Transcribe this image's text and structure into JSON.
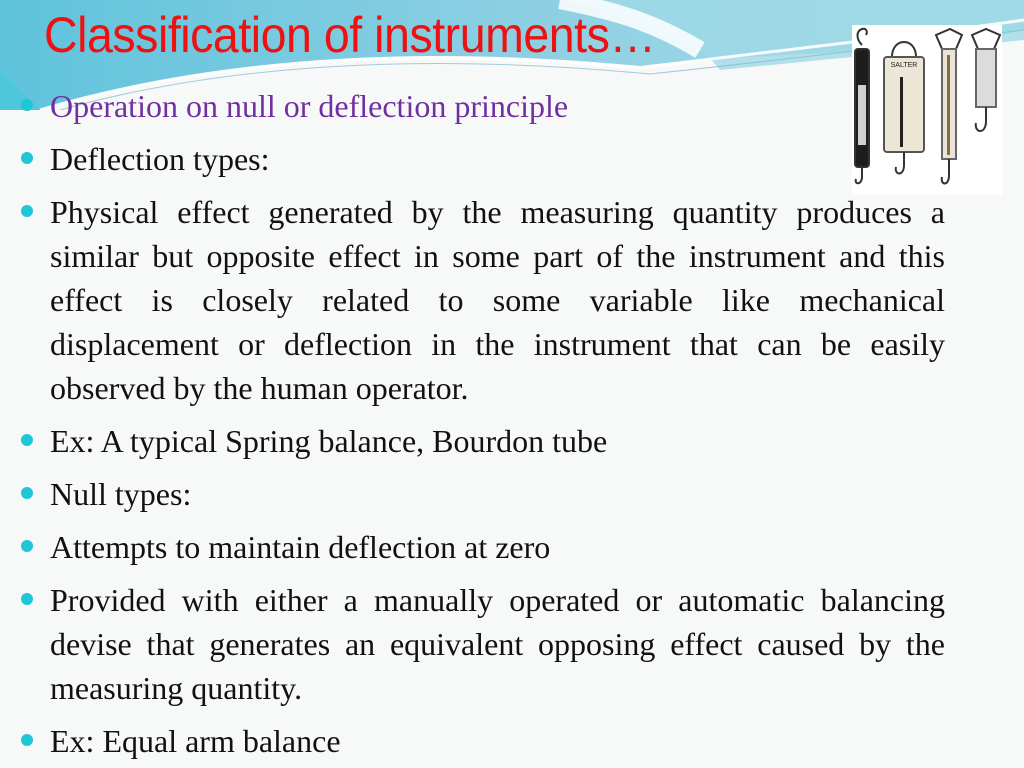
{
  "slide": {
    "title": "Classification of instruments…",
    "image_alt": "spring balances",
    "image_label": "SALTER",
    "bullets": [
      {
        "text": "Operation on null or deflection principle",
        "style": "highlight"
      },
      {
        "text": "Deflection types:",
        "style": "normal"
      },
      {
        "text": "Physical effect generated by the measuring quantity produces a similar but opposite effect in some part of the instrument and this effect is closely related to some variable like mechanical displacement or deflection in the instrument that can be easily observed by the human operator.",
        "style": "normal"
      },
      {
        "text": "Ex: A typical Spring balance, Bourdon tube",
        "style": "normal"
      },
      {
        "text": "Null types:",
        "style": "normal"
      },
      {
        "text": "Attempts to maintain deflection at zero",
        "style": "normal"
      },
      {
        "text": "Provided with either a manually operated or automatic balancing devise that generates an equivalent opposing effect caused by the measuring quantity.",
        "style": "normal"
      },
      {
        "text": "Ex: Equal arm balance",
        "style": "normal"
      }
    ]
  },
  "colors": {
    "title": "#ee1111",
    "highlight_text": "#7030a0",
    "bullet": "#1ec6d6",
    "body_text": "#111111"
  }
}
